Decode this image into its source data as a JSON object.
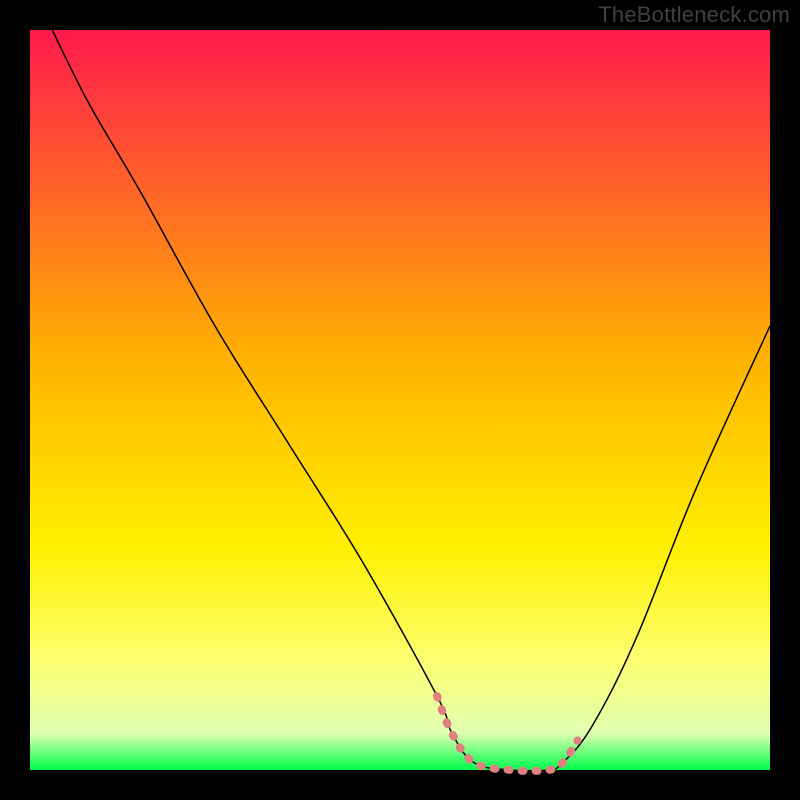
{
  "watermark": "TheBottleneck.com",
  "chart_data": {
    "type": "line",
    "title": "",
    "xlabel": "",
    "ylabel": "",
    "xlim": [
      0,
      100
    ],
    "ylim": [
      0,
      100
    ],
    "grid": false,
    "background_gradient": {
      "stops": [
        {
          "offset": 0,
          "color": "#ff1a4d"
        },
        {
          "offset": 0.45,
          "color": "#ffb400"
        },
        {
          "offset": 0.7,
          "color": "#fff000"
        },
        {
          "offset": 0.85,
          "color": "#fdff70"
        },
        {
          "offset": 0.95,
          "color": "#e0ffb0"
        },
        {
          "offset": 1.0,
          "color": "#00ff4d"
        }
      ]
    },
    "series": [
      {
        "name": "bottleneck-curve",
        "color": "#000000",
        "width": 1.5,
        "x": [
          3,
          8,
          15,
          25,
          35,
          45,
          55,
          57,
          60,
          65,
          70,
          72,
          76,
          82,
          90,
          100
        ],
        "y": [
          100,
          90,
          78,
          60,
          44,
          28,
          10,
          5,
          1,
          0,
          0,
          1,
          6,
          18,
          38,
          60
        ]
      }
    ],
    "highlight_segment": {
      "name": "optimal-zone",
      "color": "#e08080",
      "width": 8,
      "x": [
        55,
        57,
        60,
        65,
        70,
        72,
        74
      ],
      "y": [
        10,
        5,
        1,
        0,
        0,
        1,
        4
      ]
    }
  }
}
